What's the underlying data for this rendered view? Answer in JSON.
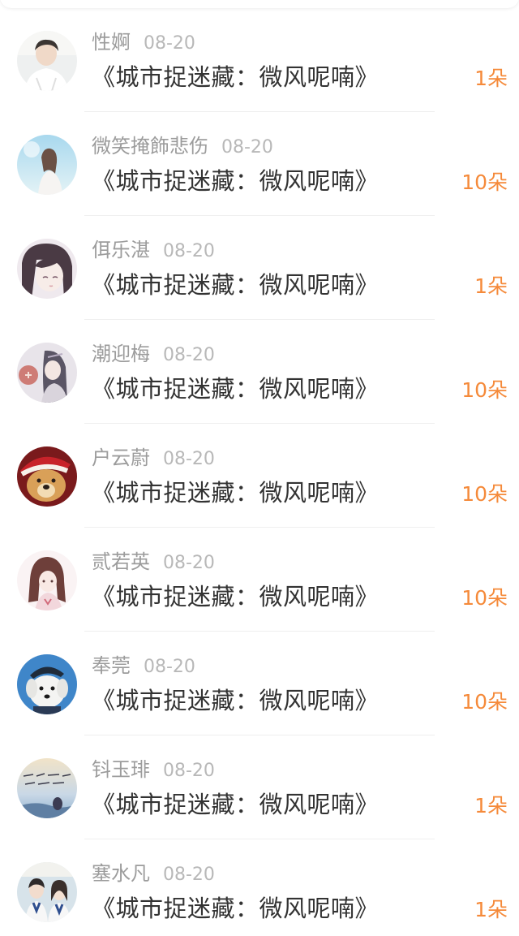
{
  "list": {
    "items": [
      {
        "name": "性婀",
        "date": "08-20",
        "gift": "《城市捉迷藏：微风呢喃》",
        "count": "1朵",
        "avatar": "avatar-boy-white-shirt"
      },
      {
        "name": "微笑掩飾悲伤",
        "date": "08-20",
        "gift": "《城市捉迷藏：微风呢喃》",
        "count": "10朵",
        "avatar": "avatar-girl-sky"
      },
      {
        "name": "佴乐湛",
        "date": "08-20",
        "gift": "《城市捉迷藏：微风呢喃》",
        "count": "1朵",
        "avatar": "avatar-anime-girl"
      },
      {
        "name": "潮迎梅",
        "date": "08-20",
        "gift": "《城市捉迷藏：微风呢喃》",
        "count": "10朵",
        "avatar": "avatar-illustration-lady"
      },
      {
        "name": "户云蔚",
        "date": "08-20",
        "gift": "《城市捉迷藏：微风呢喃》",
        "count": "10朵",
        "avatar": "avatar-dog-santa"
      },
      {
        "name": "贰若英",
        "date": "08-20",
        "gift": "《城市捉迷藏：微风呢喃》",
        "count": "10朵",
        "avatar": "avatar-anime-girl-pink"
      },
      {
        "name": "奉莞",
        "date": "08-20",
        "gift": "《城市捉迷藏：微风呢喃》",
        "count": "10朵",
        "avatar": "avatar-white-puppy"
      },
      {
        "name": "钭玉琲",
        "date": "08-20",
        "gift": "《城市捉迷藏：微风呢喃》",
        "count": "1朵",
        "avatar": "avatar-handwriting-sky"
      },
      {
        "name": "塞水凡",
        "date": "08-20",
        "gift": "《城市捉迷藏：微风呢喃》",
        "count": "1朵",
        "avatar": "avatar-students-classroom"
      }
    ]
  },
  "colors": {
    "name": "#9c9c9c",
    "date": "#b8b8b8",
    "gift": "#333333",
    "count": "#f58a3a",
    "divider": "#efefef"
  }
}
